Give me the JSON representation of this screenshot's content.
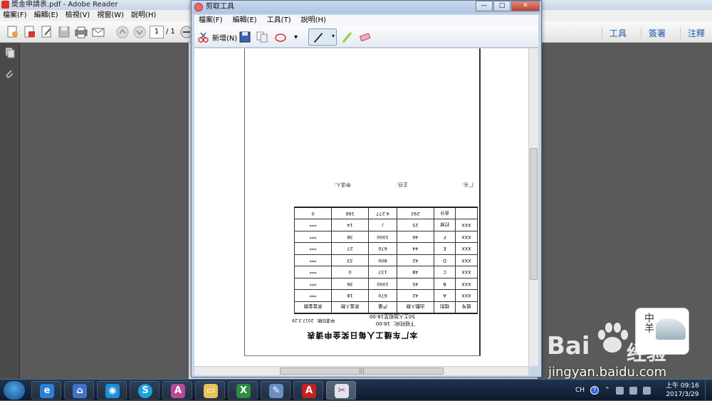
{
  "reader": {
    "title": "奬金申請表.pdf - Adobe Reader",
    "menu": [
      "檔案(F)",
      "編輯(E)",
      "檢視(V)",
      "視窗(W)",
      "說明(H)"
    ],
    "page_current": "1",
    "page_total": "/ 1",
    "right_links": [
      "工具",
      "簽署",
      "注釋"
    ]
  },
  "snip": {
    "title": "剪取工具",
    "menu": [
      "檔案(F)",
      "編輯(E)",
      "工具(T)",
      "說明(H)"
    ],
    "new_label": "新增(N)"
  },
  "document": {
    "title": "本厂车缝工人每日奖金申请表",
    "subtitle_1": "下班时间：16:00",
    "subtitle_2": "50工人加班至18:00",
    "date": "申请日期：2017.3.29",
    "headers": [
      "组号",
      "组别",
      "出勤人数",
      "产量",
      "奖金人数",
      "奖金金额"
    ],
    "rows": [
      [
        "XXX",
        "A",
        "42",
        "670",
        "18",
        "***"
      ],
      [
        "XXX",
        "B",
        "45",
        "1000",
        "36",
        "***"
      ],
      [
        "XXX",
        "C",
        "48",
        "137",
        "0",
        "***"
      ],
      [
        "XXX",
        "D",
        "42",
        "800",
        "33",
        "***"
      ],
      [
        "XXX",
        "E",
        "44",
        "670",
        "27",
        "***"
      ],
      [
        "XXX",
        "F",
        "46",
        "1000",
        "38",
        "***"
      ],
      [
        "XXX",
        "打样",
        "25",
        "/",
        "14",
        "***"
      ],
      [
        "",
        "合计",
        "292",
        "4,277",
        "166",
        "0"
      ]
    ],
    "sign_factory": "厂长:",
    "sign_manager": "主任:",
    "sign_applicant": "申请人:"
  },
  "watermark": {
    "logo_text": "中羊",
    "brand": "Bai",
    "brand_cn": "经验",
    "url": "jingyan.baidu.com"
  },
  "taskbar": {
    "ime": "CH",
    "time": "上午 09:16",
    "date": "2017/3/29"
  }
}
